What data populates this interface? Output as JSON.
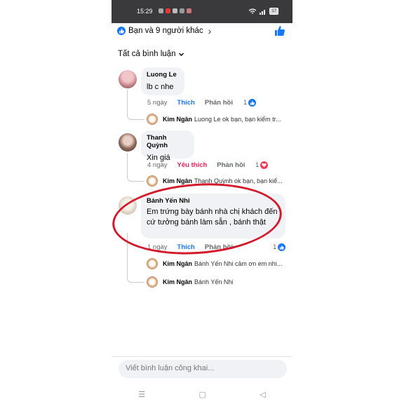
{
  "status": {
    "time": "15:29",
    "battery": "17"
  },
  "header": {
    "reactions_text": "Bạn và 9 người khác"
  },
  "filter": {
    "label": "Tất cả bình luận"
  },
  "comments": [
    {
      "author": "Luong Le",
      "text": "lb c nhe",
      "age": "5 ngày",
      "reaction_label": "Thích",
      "reply_label": "Phản hồi",
      "reaction_count": "1",
      "replies": [
        {
          "author": "Kim Ngân",
          "snippet": "Luong Le ok bạn, bạn kiểm tr..."
        }
      ]
    },
    {
      "author": "Thanh Quỳnh",
      "text": "Xin giá",
      "age": "4 ngày",
      "reaction_label": "Yêu thích",
      "reply_label": "Phản hồi",
      "reaction_count": "1",
      "replies": [
        {
          "author": "Kim Ngân",
          "snippet": "Thanh Quỳnh ok bạn, bạn kiể..."
        }
      ]
    },
    {
      "author": "Bánh Yến Nhi",
      "text": "Em trứng bày bánh nhà chị khách đến cứ tưởng bánh làm sẵn , bánh thật",
      "age": "1 ngày",
      "reaction_label": "Thích",
      "reply_label": "Phản hồi",
      "reaction_count": "1",
      "replies": [
        {
          "author": "Kim Ngân",
          "snippet": "Bánh Yến Nhi cảm ơn em nhi..."
        },
        {
          "author": "Kim Ngân",
          "snippet": "Bánh Yến Nhi"
        }
      ]
    }
  ],
  "composer": {
    "placeholder": "Viết bình luận công khai..."
  },
  "colors": {
    "accent": "#1877f2",
    "love": "#e0245e",
    "annotation": "#d21a2a"
  }
}
